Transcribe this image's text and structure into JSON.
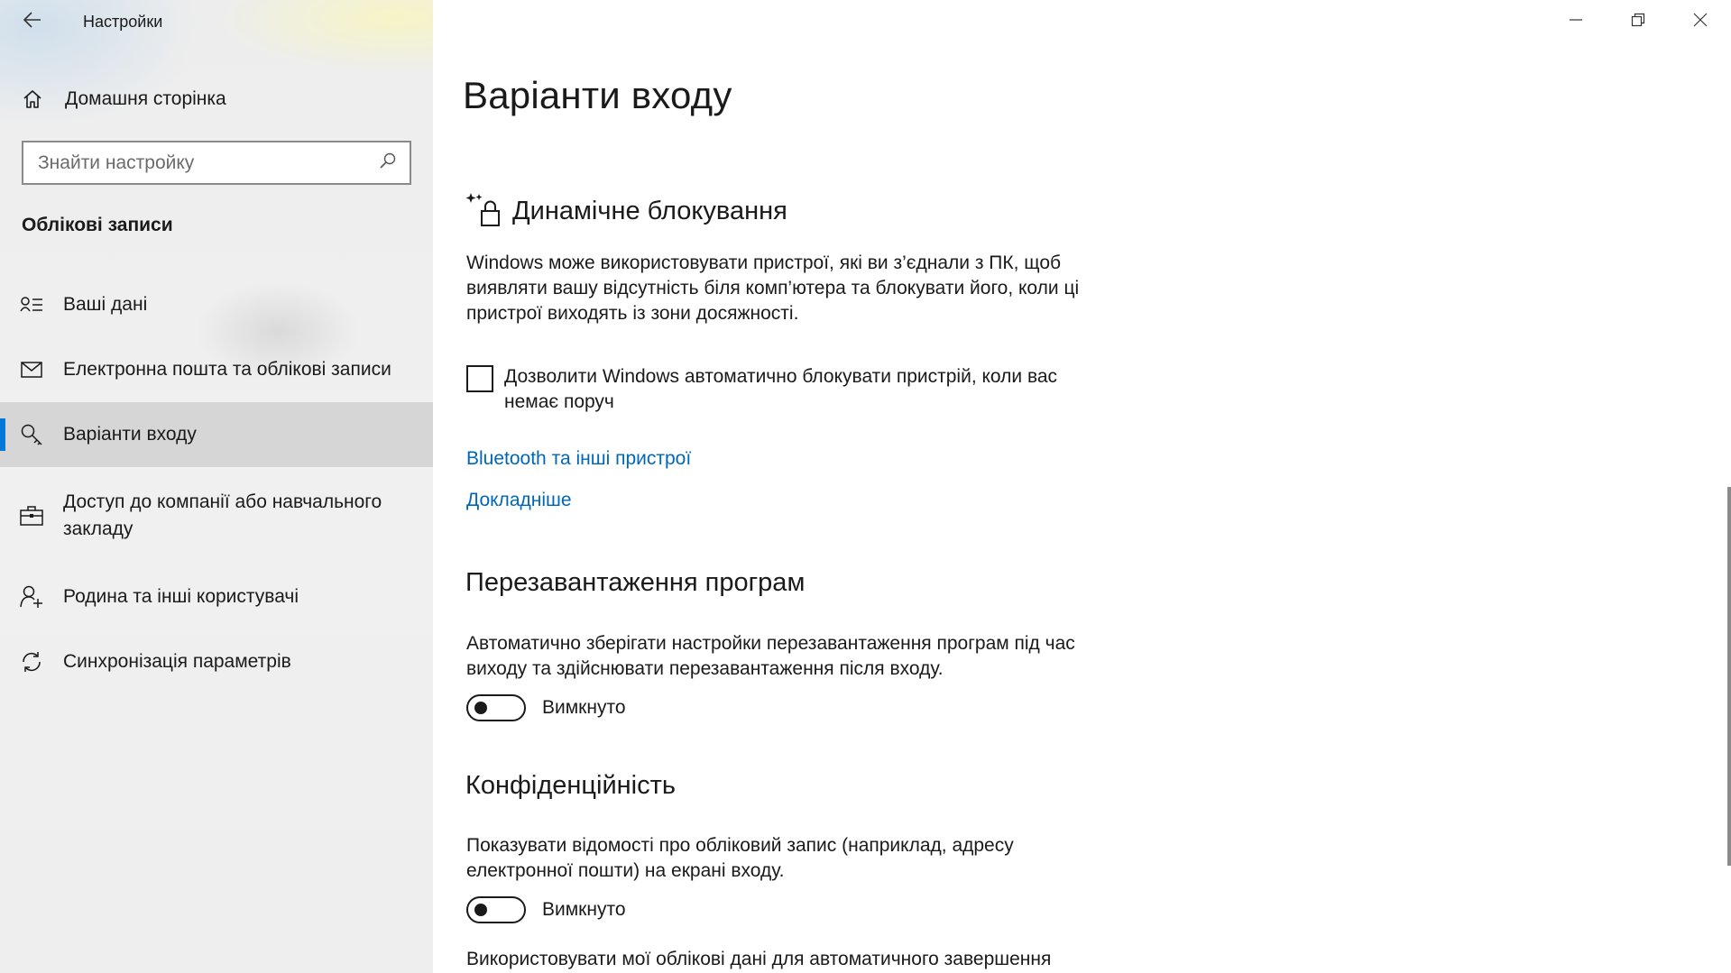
{
  "app": {
    "title": "Настройки"
  },
  "sidebar": {
    "home_label": "Домашня сторінка",
    "search_placeholder": "Знайти настройку",
    "group_title": "Облікові записи",
    "items": [
      {
        "label": "Ваші дані",
        "icon": "person-card-icon"
      },
      {
        "label": "Електронна пошта та облікові записи",
        "icon": "mail-icon"
      },
      {
        "label": "Варіанти входу",
        "icon": "key-icon",
        "selected": true
      },
      {
        "label": "Доступ до компанії або навчального закладу",
        "icon": "briefcase-icon"
      },
      {
        "label": "Родина та інші користувачі",
        "icon": "person-add-icon"
      },
      {
        "label": "Синхронізація параметрів",
        "icon": "sync-icon"
      }
    ]
  },
  "main": {
    "page_title": "Варіанти входу",
    "dynamic_lock": {
      "title": "Динамічне блокування",
      "description": "Windows може використовувати пристрої, які ви з’єднали з ПК, щоб виявляти вашу відсутність біля комп’ютера та блокувати його, коли ці пристрої виходять із зони досяжності.",
      "checkbox_label": "Дозволити Windows автоматично блокувати пристрій, коли вас немає поруч",
      "checkbox_checked": false,
      "link_bluetooth": "Bluetooth та інші пристрої",
      "link_more": "Докладніше"
    },
    "app_restart": {
      "title": "Перезавантаження програм",
      "description": "Автоматично зберігати настройки перезавантаження програм під час виходу та здійснювати перезавантаження після входу.",
      "toggle_state": "Вимкнуто",
      "toggle_on": false
    },
    "privacy": {
      "title": "Конфіденційність",
      "description": "Показувати відомості про обліковий запис (наприклад, адресу електронної пошти) на екрані входу.",
      "toggle_state": "Вимкнуто",
      "toggle_on": false,
      "next_text": "Використовувати мої облікові дані для автоматичного завершення"
    }
  },
  "colors": {
    "accent": "#0078d7",
    "link": "#0067b8",
    "selected_bg": "#cdcdcd"
  }
}
